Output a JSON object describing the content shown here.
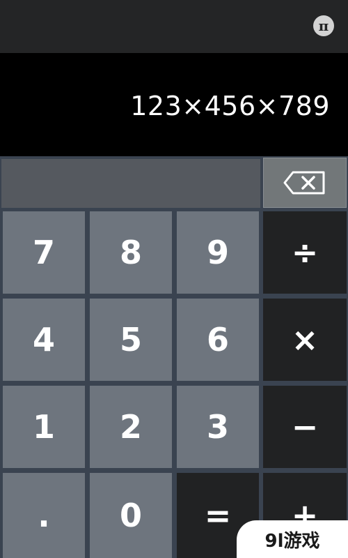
{
  "topbar": {
    "pi_label": "π"
  },
  "display": {
    "expression": "123×456×789"
  },
  "keys": {
    "k7": "7",
    "k8": "8",
    "k9": "9",
    "divide": "÷",
    "k4": "4",
    "k5": "5",
    "k6": "6",
    "multiply": "×",
    "k1": "1",
    "k2": "2",
    "k3": "3",
    "minus": "−",
    "dot": ".",
    "k0": "0",
    "equals": "=",
    "plus": "+"
  },
  "icons": {
    "backspace": "backspace-icon"
  },
  "watermark": {
    "text": "9l游戏"
  },
  "colors": {
    "topbar": "#242526",
    "display": "#000000",
    "digit_key": "#6e757e",
    "operator_key": "#212223",
    "background": "#3a4350"
  }
}
